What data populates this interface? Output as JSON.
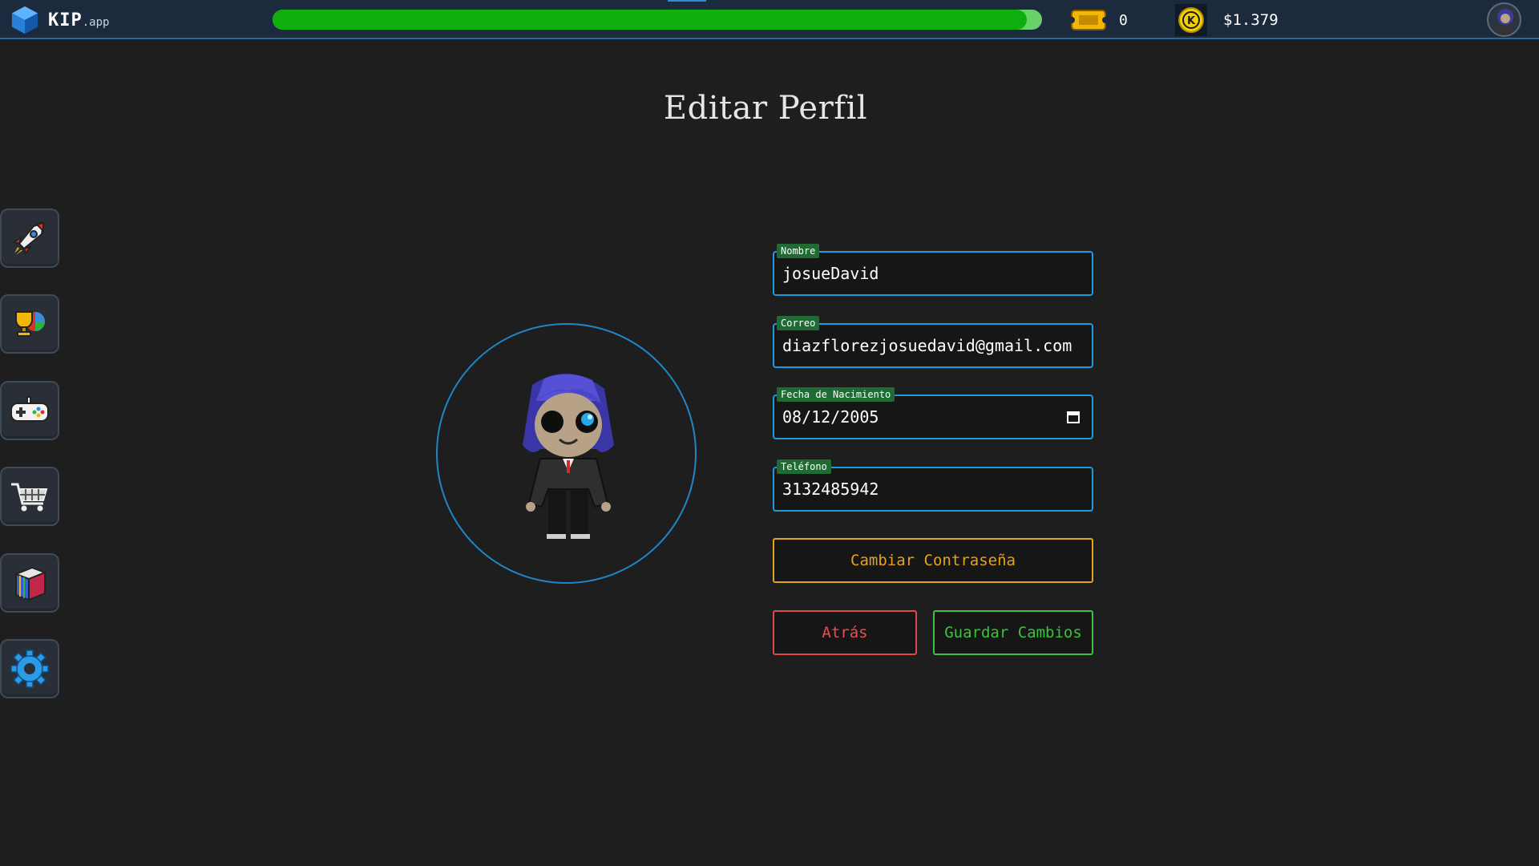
{
  "app": {
    "name": "KIP",
    "suffix": ".app"
  },
  "topbar": {
    "xp_progress": 0.98,
    "tickets": "0",
    "balance": "$1.379",
    "coin_symbol": "K"
  },
  "sidebar": {
    "items": [
      {
        "icon": "rocket-icon"
      },
      {
        "icon": "trophy-icon"
      },
      {
        "icon": "gamepad-icon"
      },
      {
        "icon": "cart-icon"
      },
      {
        "icon": "books-icon"
      },
      {
        "icon": "gear-icon"
      }
    ]
  },
  "page": {
    "title": "Editar Perfil"
  },
  "form": {
    "nombre": {
      "label": "Nombre",
      "value": "josueDavid"
    },
    "correo": {
      "label": "Correo",
      "value": "diazflorezjosuedavid@gmail.com"
    },
    "fecha": {
      "label": "Fecha de Nacimiento",
      "value": "08/12/2005"
    },
    "telefono": {
      "label": "Teléfono",
      "value": "3132485942"
    },
    "change_password_label": "Cambiar Contraseña",
    "back_label": "Atrás",
    "save_label": "Guardar Cambios"
  },
  "colors": {
    "accent_blue": "#1e9be0",
    "xp_green": "#0fae0f",
    "warning_orange": "#e5a21c",
    "danger_red": "#e04848",
    "success_green": "#3cc23c"
  }
}
